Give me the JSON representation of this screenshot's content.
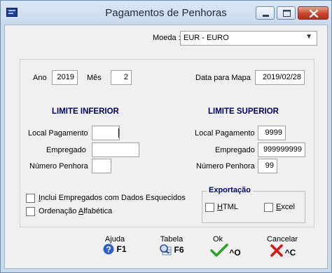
{
  "window": {
    "title": "Pagamentos de Penhoras"
  },
  "moeda": {
    "label": "Moeda :",
    "value": "EUR - EURO"
  },
  "periodo": {
    "ano_label": "Ano",
    "ano_value": "2019",
    "mes_label": "Mês",
    "mes_value": "2",
    "data_mapa_label": "Data para Mapa",
    "data_mapa_value": "2019/02/28"
  },
  "limite_inferior": {
    "header": "LIMITE INFERIOR",
    "local_pagamento_label": "Local Pagamento",
    "local_pagamento_value": "",
    "empregado_label": "Empregado",
    "empregado_value": "",
    "numero_penhora_label": "Número Penhora",
    "numero_penhora_value": ""
  },
  "limite_superior": {
    "header": "LIMITE SUPERIOR",
    "local_pagamento_label": "Local Pagamento",
    "local_pagamento_value": "9999",
    "empregado_label": "Empregado",
    "empregado_value": "999999999",
    "numero_penhora_label": "Número Penhora",
    "numero_penhora_value": "99"
  },
  "opcoes": {
    "incluir_esquecidos_pre": "",
    "incluir_esquecidos_u": "I",
    "incluir_esquecidos_post": "nclui Empregados com Dados Esquecidos",
    "incluir_esquecidos_checked": false,
    "ordenacao_pre": "Ordenação ",
    "ordenacao_u": "A",
    "ordenacao_post": "lfabética",
    "ordenacao_checked": false
  },
  "exportacao": {
    "title": "Exportação",
    "html_u": "H",
    "html_post": "TML",
    "html_checked": false,
    "excel_u": "E",
    "excel_post": "xcel",
    "excel_checked": false
  },
  "toolbar": {
    "ajuda_label": "Ajuda",
    "ajuda_key": "F1",
    "tabela_label": "Tabela",
    "tabela_key": "F6",
    "ok_label": "Ok",
    "ok_key": "^O",
    "cancelar_label": "Cancelar",
    "cancelar_key": "^C"
  },
  "colors": {
    "header_text": "#000066",
    "ok_green": "#2ca12c",
    "cancel_red": "#d41a1a",
    "help_blue": "#2f5fc4"
  }
}
